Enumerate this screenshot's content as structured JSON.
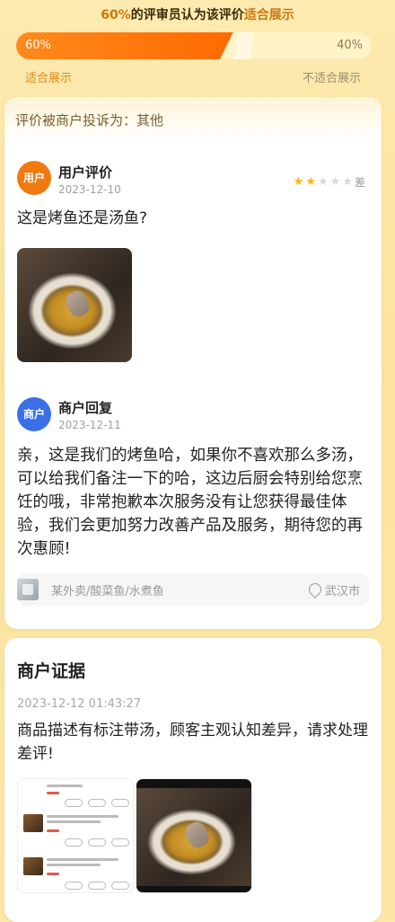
{
  "vote": {
    "title_pct": "60%",
    "title_mid": "的评审员认为该评价",
    "title_hl": "适合展示",
    "left_pct": "60%",
    "right_pct": "40%",
    "left_fraction": 0.6,
    "left_label": "适合展示",
    "right_label": "不适合展示"
  },
  "complaint": "评价被商户投诉为：其他",
  "user_review": {
    "avatar": "用户",
    "name": "用户评价",
    "date": "2023-12-10",
    "rating_stars": 2,
    "max_stars": 5,
    "rating_label": "差",
    "text": "这是烤鱼还是汤鱼?"
  },
  "merchant_reply": {
    "avatar": "商户",
    "name": "商户回复",
    "date": "2023-12-11",
    "text": "亲，这是我们的烤鱼哈，如果你不喜欢那么多汤，可以给我们备注一下的哈，这边后厨会特别给您烹饪的哦，非常抱歉本次服务没有让您获得最佳体验，我们会更加努力改善产品及服务，期待您的再次惠顾!"
  },
  "tag": {
    "category": "某外卖/酸菜鱼/水煮鱼",
    "location": "武汉市"
  },
  "evidence": {
    "title": "商户证据",
    "datetime": "2023-12-12 01:43:27",
    "text": "商品描述有标注带汤，顾客主观认知差异，请求处理差评!"
  },
  "colors": {
    "accent": "#ff7a10",
    "user_avatar": "#f07a10",
    "merchant_avatar": "#3b6fe8",
    "star_on": "#f6b61e",
    "star_off": "#d8d8d8"
  }
}
